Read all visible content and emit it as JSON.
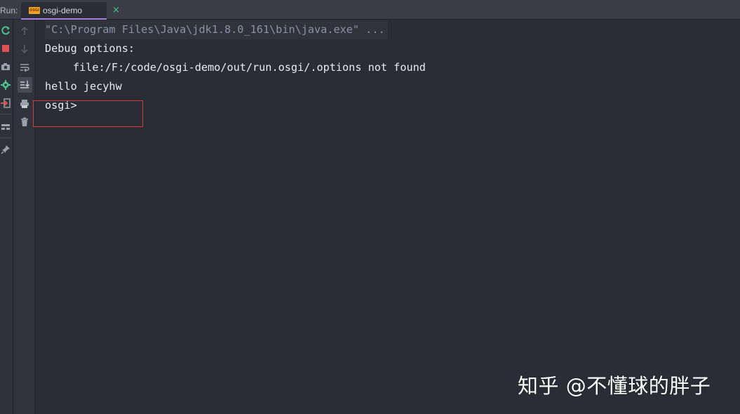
{
  "run_panel": {
    "label": "Run:",
    "tab": {
      "icon_text": "OSGI",
      "title": "osgi-demo",
      "close_glyph": "×"
    }
  },
  "console": {
    "lines": [
      "\"C:\\Program Files\\Java\\jdk1.8.0_161\\bin\\java.exe\" ...",
      "Debug options:",
      "file:/F:/code/osgi-demo/out/run.osgi/.options not found",
      "hello jecyhw",
      "osgi>"
    ]
  },
  "toolbar": {
    "icons": [
      "rerun-icon",
      "stop-icon",
      "camera-icon",
      "debug-gear-icon",
      "exit-icon",
      "layout-icon",
      "pin-icon"
    ],
    "inner_icons": [
      "up-arrow-icon",
      "down-arrow-icon",
      "soft-wrap-icon",
      "scroll-to-end-icon",
      "print-icon",
      "trash-icon"
    ]
  },
  "watermark": {
    "text": "知乎 @不懂球的胖子"
  },
  "colors": {
    "background": "#2b2d36",
    "accent_tab": "#a57fe0",
    "highlight_box": "#d23a3a",
    "rerun_green": "#4fc08d",
    "stop_red": "#e05252"
  }
}
